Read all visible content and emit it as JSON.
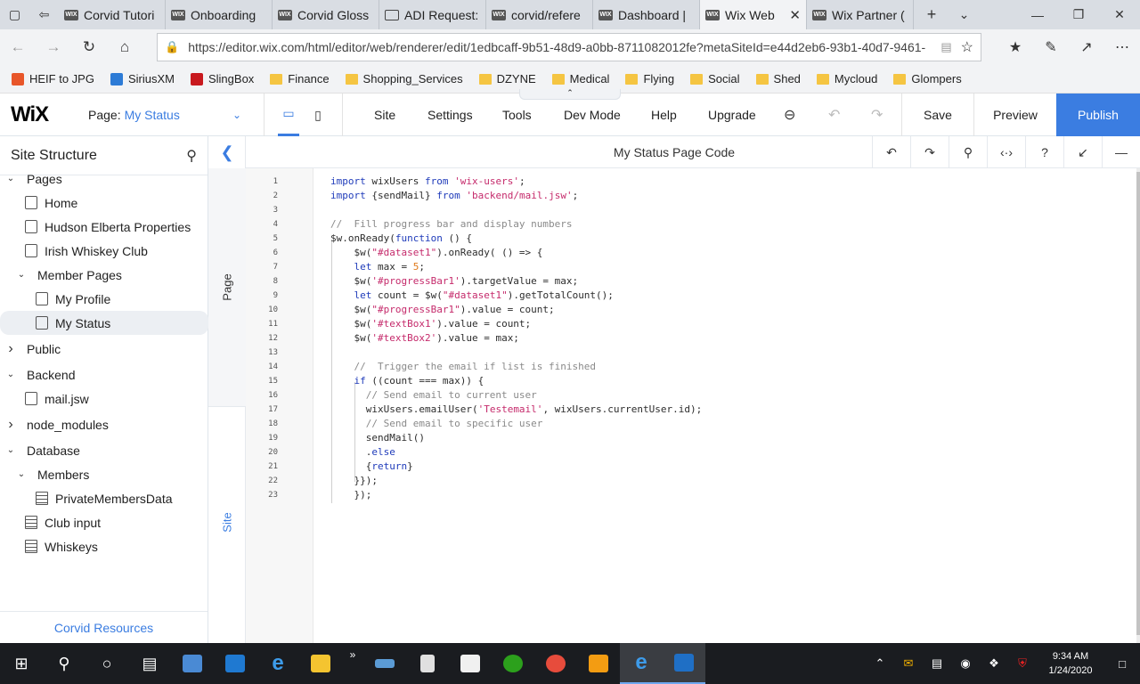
{
  "browser": {
    "tabs": [
      {
        "title": "Corvid Tutori",
        "favicon": "wix",
        "active": false
      },
      {
        "title": "Onboarding",
        "favicon": "wix",
        "active": false
      },
      {
        "title": "Corvid Gloss",
        "favicon": "wix",
        "active": false
      },
      {
        "title": "ADI Request:",
        "favicon": "doc",
        "active": false
      },
      {
        "title": "corvid/refere",
        "favicon": "wix",
        "active": false
      },
      {
        "title": "Dashboard |",
        "favicon": "wix",
        "active": false
      },
      {
        "title": "Wix Web",
        "favicon": "wix",
        "active": true
      },
      {
        "title": "Wix Partner (",
        "favicon": "wix",
        "active": false
      }
    ],
    "url": "https://editor.wix.com/html/editor/web/renderer/edit/1edbcaff-9b51-48d9-a0bb-8711082012fe?metaSiteId=e44d2eb6-93b1-40d7-9461-",
    "bookmarks": [
      {
        "label": "HEIF to JPG",
        "icon": "app-icon",
        "color": "#e8562a"
      },
      {
        "label": "SiriusXM",
        "icon": "sirius-icon",
        "color": "#2d7bd6"
      },
      {
        "label": "SlingBox",
        "icon": "sling-icon",
        "color": "#c8191e"
      },
      {
        "label": "Finance",
        "icon": "folder-icon"
      },
      {
        "label": "Shopping_Services",
        "icon": "folder-icon"
      },
      {
        "label": "DZYNE",
        "icon": "folder-icon"
      },
      {
        "label": "Medical",
        "icon": "folder-icon"
      },
      {
        "label": "Flying",
        "icon": "folder-icon"
      },
      {
        "label": "Social",
        "icon": "folder-icon"
      },
      {
        "label": "Shed",
        "icon": "folder-icon"
      },
      {
        "label": "Mycloud",
        "icon": "folder-icon"
      },
      {
        "label": "Glompers",
        "icon": "folder-icon"
      }
    ]
  },
  "wix": {
    "logo": "WiX",
    "page_label": "Page:",
    "page_value": "My Status",
    "menu": [
      "Site",
      "Settings",
      "Tools",
      "Dev Mode",
      "Help",
      "Upgrade"
    ],
    "save": "Save",
    "preview": "Preview",
    "publish": "Publish",
    "accent": "#3b7de1"
  },
  "sidebar": {
    "title": "Site Structure",
    "items": [
      {
        "label": "Pages",
        "level": 0,
        "twisty": "down",
        "icon": ""
      },
      {
        "label": "Home",
        "level": 1,
        "twisty": "",
        "icon": "page-icon"
      },
      {
        "label": "Hudson Elberta Properties",
        "level": 1,
        "twisty": "",
        "icon": "page-icon"
      },
      {
        "label": "Irish Whiskey Club",
        "level": 1,
        "twisty": "",
        "icon": "page-icon"
      },
      {
        "label": "Member Pages",
        "level": 1,
        "twisty": "down",
        "icon": ""
      },
      {
        "label": "My Profile",
        "level": 2,
        "twisty": "",
        "icon": "member-page-icon"
      },
      {
        "label": "My Status",
        "level": 2,
        "twisty": "",
        "icon": "member-page-icon",
        "selected": true
      },
      {
        "label": "Public",
        "level": 0,
        "twisty": "right",
        "icon": ""
      },
      {
        "label": "Backend",
        "level": 0,
        "twisty": "down",
        "icon": ""
      },
      {
        "label": "mail.jsw",
        "level": 1,
        "twisty": "",
        "icon": "file-icon"
      },
      {
        "label": "node_modules",
        "level": 0,
        "twisty": "right",
        "icon": ""
      },
      {
        "label": "Database",
        "level": 0,
        "twisty": "down",
        "icon": ""
      },
      {
        "label": "Members",
        "level": 1,
        "twisty": "down",
        "icon": ""
      },
      {
        "label": "PrivateMembersData",
        "level": 2,
        "twisty": "",
        "icon": "collection-icon"
      },
      {
        "label": "Club input",
        "level": 1,
        "twisty": "",
        "icon": "collection-icon"
      },
      {
        "label": "Whiskeys",
        "level": 1,
        "twisty": "",
        "icon": "collection-icon"
      }
    ],
    "footer": "Corvid Resources"
  },
  "rail": {
    "page_tab": "Page",
    "site_tab": "Site"
  },
  "code_panel": {
    "title": "My Status Page Code",
    "lines": [
      "import wixUsers from 'wix-users';",
      "import {sendMail} from 'backend/mail.jsw';",
      "",
      "//  Fill progress bar and display numbers",
      "$w.onReady(function () {",
      "    $w(\"#dataset1\").onReady( () => {",
      "    let max = 5;",
      "    $w('#progressBar1').targetValue = max;",
      "    let count = $w(\"#dataset1\").getTotalCount();",
      "    $w(\"#progressBar1\").value = count;",
      "    $w('#textBox1').value = count;",
      "    $w('#textBox2').value = max;",
      "",
      "    //  Trigger the email if list is finished",
      "    if ((count === max)) {",
      "      // Send email to current user",
      "      wixUsers.emailUser('Testemail', wixUsers.currentUser.id);",
      "      // Send email to specific user",
      "      sendMail()",
      "      .else",
      "      {return}",
      "    }});",
      "    });"
    ]
  },
  "taskbar": {
    "time": "9:34 AM",
    "date": "1/24/2020"
  }
}
